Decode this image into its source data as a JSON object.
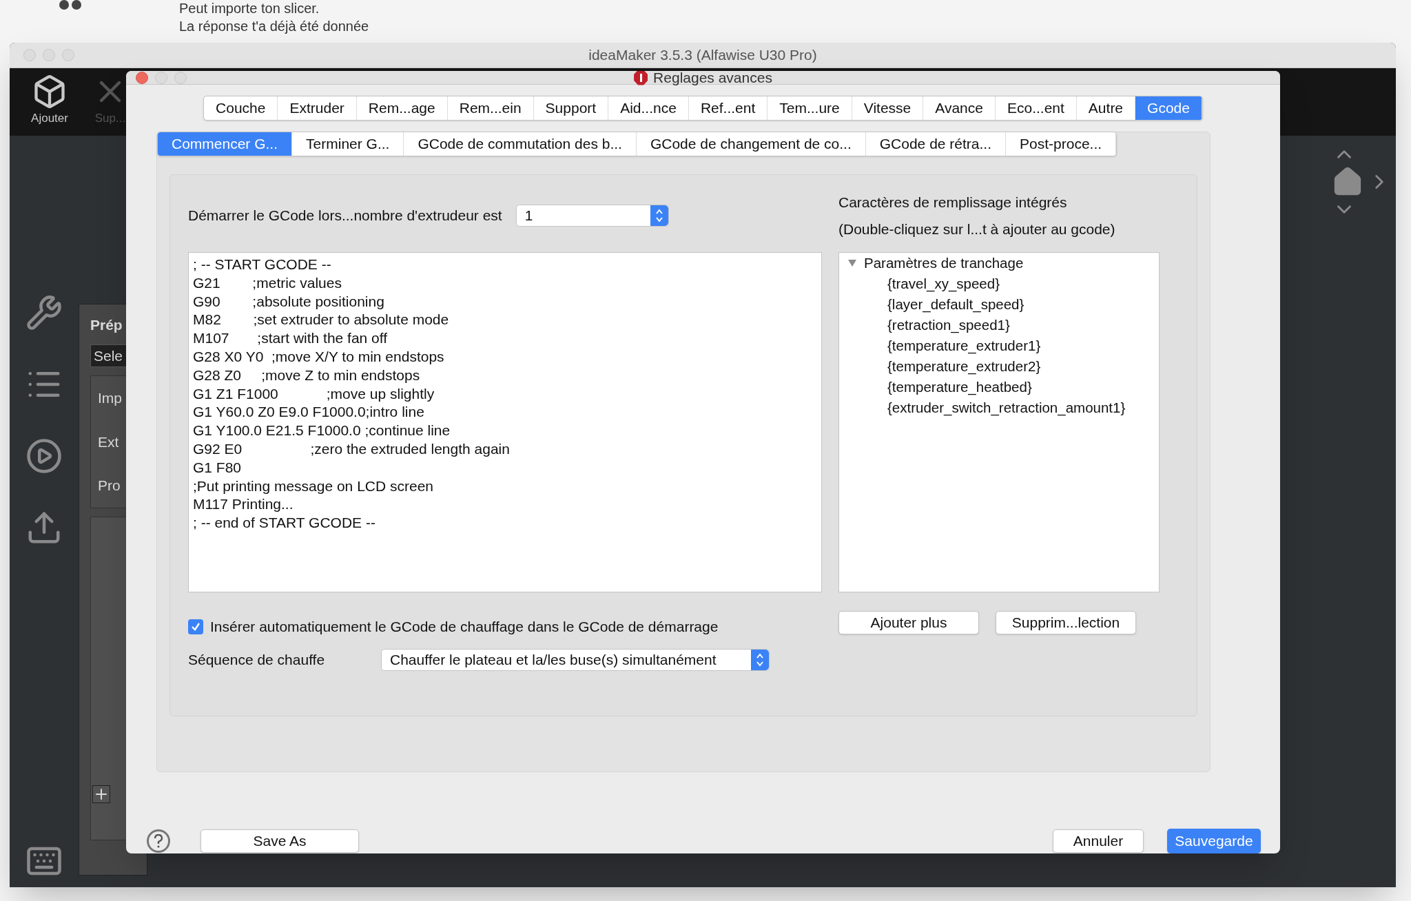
{
  "background_page": {
    "lines": [
      "Peut importe ton slicer.",
      "La réponse t'a déjà été donnée"
    ]
  },
  "window": {
    "title": "ideaMaker 3.5.3 (Alfawise U30 Pro)"
  },
  "toolbar": [
    {
      "label": "Ajouter",
      "kind": "add"
    },
    {
      "label": "Sup...",
      "kind": "remove"
    }
  ],
  "left_panel": {
    "title": "Prép",
    "dropdown": "Sele",
    "items": [
      "Imp",
      "Ext",
      "Pro"
    ]
  },
  "dialog": {
    "title": "Reglages avances",
    "tabs": [
      {
        "label": "Couche",
        "selected": false
      },
      {
        "label": "Extruder",
        "selected": false
      },
      {
        "label": "Rem...age",
        "selected": false
      },
      {
        "label": "Rem...ein",
        "selected": false
      },
      {
        "label": "Support",
        "selected": false
      },
      {
        "label": "Aid...nce",
        "selected": false
      },
      {
        "label": "Ref...ent",
        "selected": false
      },
      {
        "label": "Tem...ure",
        "selected": false
      },
      {
        "label": "Vitesse",
        "selected": false
      },
      {
        "label": "Avance",
        "selected": false
      },
      {
        "label": "Eco...ent",
        "selected": false
      },
      {
        "label": "Autre",
        "selected": false
      },
      {
        "label": "Gcode",
        "selected": true
      }
    ],
    "subtabs": [
      {
        "label": "Commencer G...",
        "selected": true
      },
      {
        "label": "Terminer G...",
        "selected": false
      },
      {
        "label": "GCode de commutation des b...",
        "selected": false
      },
      {
        "label": "GCode de changement de co...",
        "selected": false
      },
      {
        "label": "GCode de rétra...",
        "selected": false
      },
      {
        "label": "Post-proce...",
        "selected": false
      }
    ],
    "extruder_count": {
      "label": "Démarrer le GCode lors...nombre d'extrudeur est",
      "value": "1"
    },
    "gcode_lines": [
      "; -- START GCODE --",
      "G21        ;metric values",
      "G90        ;absolute positioning",
      "M82        ;set extruder to absolute mode",
      "M107       ;start with the fan off",
      "G28 X0 Y0  ;move X/Y to min endstops",
      "G28 Z0     ;move Z to min endstops",
      "G1 Z1 F1000            ;move up slightly",
      "G1 Y60.0 Z0 E9.0 F1000.0;intro line",
      "G1 Y100.0 E21.5 F1000.0 ;continue line",
      "G92 E0                 ;zero the extruded length again",
      "G1 F80",
      ";Put printing message on LCD screen",
      "M117 Printing...",
      "; -- end of START GCODE --"
    ],
    "placeholders_header": [
      "Caractères de remplissage intégrés",
      "(Double-cliquez sur l...t à ajouter au gcode)"
    ],
    "tree": [
      {
        "label": "Paramètres de tranchage",
        "expanded": true,
        "children": [
          {
            "label": "{travel_xy_speed}"
          },
          {
            "label": "{layer_default_speed}"
          },
          {
            "label": "{retraction_speed1}"
          },
          {
            "label": "{temperature_extruder1}"
          },
          {
            "label": "{temperature_extruder2}"
          },
          {
            "label": "{temperature_heatbed}"
          },
          {
            "label": "{extruder_switch_retraction_amount1}"
          }
        ]
      }
    ],
    "auto_heat": {
      "label": "Insérer automatiquement le GCode de chauffage dans le GCode de démarrage",
      "checked": true
    },
    "tree_buttons": [
      "Ajouter plus",
      "Supprim...lection"
    ],
    "heat_sequence": {
      "label": "Séquence de chauffe",
      "value": "Chauffer le plateau et la/les buse(s) simultanément"
    },
    "footer": {
      "left_button": "Save As",
      "cancel": "Annuler",
      "save": "Sauvegarde"
    }
  }
}
